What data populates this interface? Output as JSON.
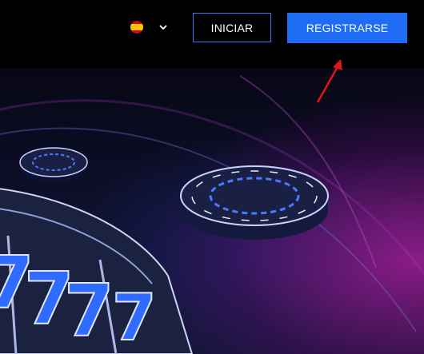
{
  "header": {
    "language_flag_icon": "spain-flag-icon",
    "language_dropdown_icon": "chevron-down-icon",
    "login_label": "INICIAR",
    "register_label": "REGISTRARSE"
  },
  "colors": {
    "accent": "#1d6cf3",
    "outline": "#3a78f2",
    "annotation": "#e0141c"
  }
}
